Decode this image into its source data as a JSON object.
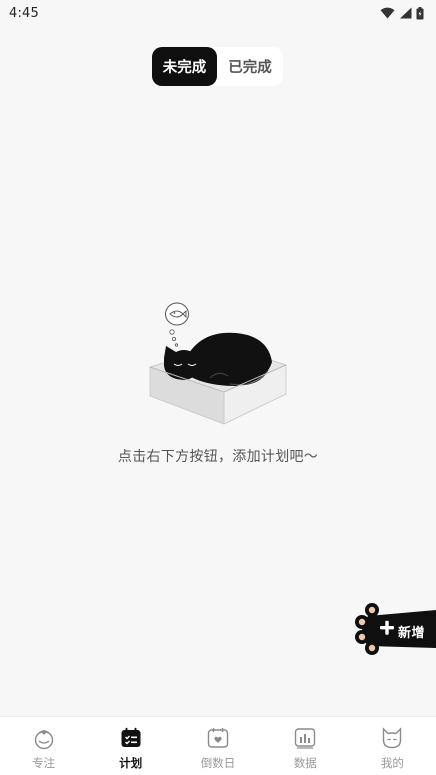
{
  "status_bar": {
    "time": "4:45",
    "icons": [
      "wifi-icon",
      "signal-icon",
      "battery-icon"
    ]
  },
  "segmented_tabs": {
    "active": "未完成",
    "inactive": "已完成"
  },
  "empty_state": {
    "illustration": "sleeping-cat-in-box",
    "message": "点击右下方按钮，添加计划吧～"
  },
  "add_button": {
    "label": "新增",
    "icon": "paw-plus-icon"
  },
  "bottom_nav": {
    "items": [
      {
        "label": "专注",
        "icon": "tomato-icon",
        "active": false
      },
      {
        "label": "计划",
        "icon": "calendar-list-icon",
        "active": true
      },
      {
        "label": "倒数日",
        "icon": "calendar-heart-icon",
        "active": false
      },
      {
        "label": "数据",
        "icon": "bar-chart-icon",
        "active": false
      },
      {
        "label": "我的",
        "icon": "cat-face-icon",
        "active": false
      }
    ]
  },
  "colors": {
    "background": "#f7f7f7",
    "accent": "#0f0f0f",
    "inactive_text": "#999999"
  }
}
